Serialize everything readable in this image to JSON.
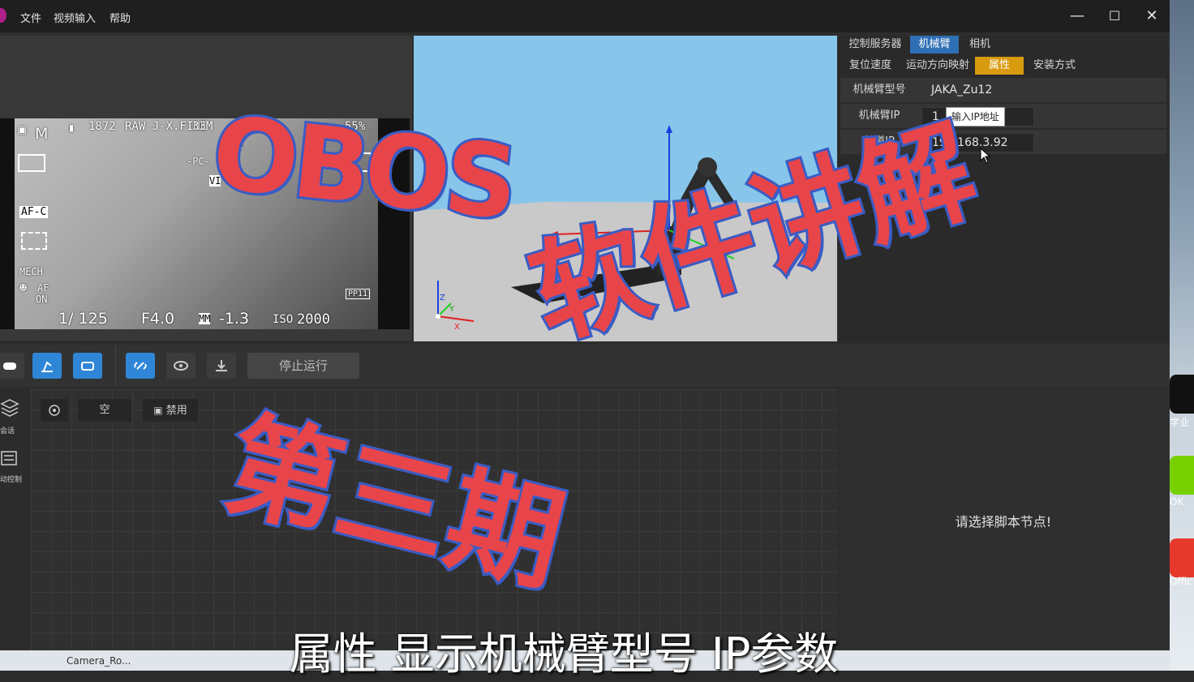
{
  "menu": {
    "file": "文件",
    "video_input": "视频输入",
    "help": "帮助"
  },
  "window_controls": {
    "minimize": "—",
    "maximize": "☐",
    "close": "✕"
  },
  "camera_osd": {
    "mode": "M",
    "shots": "1872",
    "quality": "RAW J-X.FINE",
    "size": "33M",
    "battery": "55%",
    "pc": "-PC-",
    "on": "ON",
    "vi": "VI",
    "afc": "AF-C",
    "mech": "MECH",
    "af_on_a": "AF",
    "af_on_b": "ON",
    "pp": "PP11",
    "shutter": "1/ 125",
    "aperture": "F4.0",
    "mm": "MM",
    "ev": "-1.3",
    "iso_label": "ISO",
    "iso_value": "2000"
  },
  "viewport3d": {
    "axis_z": "Z",
    "axis_x": "X",
    "axis_y": "Y"
  },
  "props": {
    "tabs_top": [
      "控制服务器",
      "机械臂",
      "相机"
    ],
    "tabs_sub": [
      "复位速度",
      "运动方向映射",
      "属性",
      "安装方式"
    ],
    "rows": [
      {
        "label": "机械臂型号",
        "value": "JAKA_Zu12"
      },
      {
        "label": "机械臂IP",
        "value": "1",
        "tooltip": "输入IP地址"
      },
      {
        "label": "轨道IP",
        "value": "192.168.3.92"
      }
    ]
  },
  "toolbar": {
    "stop_label": "停止运行"
  },
  "sidebar": {
    "session": "会话",
    "motion_control": "动控制"
  },
  "workspace": {
    "chip_empty": "空",
    "chip_disabled": "禁用"
  },
  "script_panel": {
    "placeholder": "请选择脚本节点!"
  },
  "overlay": {
    "obos": "OBOS",
    "software": "软件讲解",
    "episode": "第三期"
  },
  "subtitle": "属性 显示机械臂型号 IP参数",
  "taskbar": {
    "item": "Camera_Ro..."
  },
  "desktop_labels": [
    "学业",
    "OK",
    "Offic"
  ],
  "colors": {
    "accent_blue": "#2f6fb5",
    "accent_gold": "#d89a0e",
    "sky": "#87c6ea",
    "overlay_red": "#e8454a",
    "overlay_blue": "#3a5cc4"
  }
}
